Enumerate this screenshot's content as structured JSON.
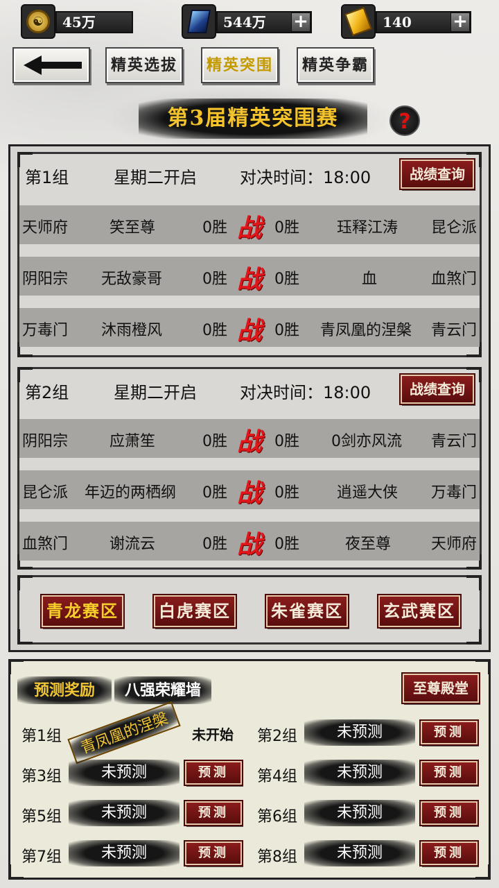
{
  "resources": [
    {
      "icon": "taiji-coin-icon",
      "value": "45万",
      "has_plus": false
    },
    {
      "icon": "blue-gem-icon",
      "value": "544万",
      "has_plus": true
    },
    {
      "icon": "gold-ingot-icon",
      "value": "140",
      "has_plus": true
    }
  ],
  "tabs": [
    {
      "label": "精英选拔",
      "active": false
    },
    {
      "label": "精英突围",
      "active": true
    },
    {
      "label": "精英争霸",
      "active": false
    }
  ],
  "title": "第3届精英突围赛",
  "help_symbol": "?",
  "groups": [
    {
      "name": "第1组",
      "open_day": "星期二开启",
      "duel_time": "对决时间：18:00",
      "record_button": "战绩查询",
      "matches": [
        {
          "left_sect": "天师府",
          "left_player": "笑至尊",
          "left_wins": "0胜",
          "vs": "战",
          "right_wins": "0胜",
          "right_player": "珏释江涛",
          "right_sect": "昆仑派"
        },
        {
          "left_sect": "阴阳宗",
          "left_player": "无敌豪哥",
          "left_wins": "0胜",
          "vs": "战",
          "right_wins": "0胜",
          "right_player": "血",
          "right_sect": "血煞门"
        },
        {
          "left_sect": "万毒门",
          "left_player": "沐雨橙风",
          "left_wins": "0胜",
          "vs": "战",
          "right_wins": "0胜",
          "right_player": "青凤凰的涅槃",
          "right_sect": "青云门"
        }
      ]
    },
    {
      "name": "第2组",
      "open_day": "星期二开启",
      "duel_time": "对决时间：18:00",
      "record_button": "战绩查询",
      "matches": [
        {
          "left_sect": "阴阳宗",
          "left_player": "应萧笙",
          "left_wins": "0胜",
          "vs": "战",
          "right_wins": "0胜",
          "right_player": "0剑亦风流",
          "right_sect": "青云门"
        },
        {
          "left_sect": "昆仑派",
          "left_player": "年迈的两栖纲",
          "left_wins": "0胜",
          "vs": "战",
          "right_wins": "0胜",
          "right_player": "逍遥大侠",
          "right_sect": "万毒门"
        },
        {
          "left_sect": "血煞门",
          "left_player": "谢流云",
          "left_wins": "0胜",
          "vs": "战",
          "right_wins": "0胜",
          "right_player": "夜至尊",
          "right_sect": "天师府"
        }
      ]
    }
  ],
  "zones": [
    {
      "label": "青龙赛区",
      "active": true
    },
    {
      "label": "白虎赛区",
      "active": false
    },
    {
      "label": "朱雀赛区",
      "active": false
    },
    {
      "label": "玄武赛区",
      "active": false
    }
  ],
  "prediction": {
    "tab_reward": "预测奖励",
    "tab_wall": "八强荣耀墙",
    "supreme_button": "至尊殿堂",
    "predict_button": "预测",
    "cells": [
      {
        "group": "第1组",
        "value": "青凤凰的涅槃",
        "status": "未开始",
        "highlight": true
      },
      {
        "group": "第2组",
        "value": "未预测",
        "status": "",
        "highlight": false
      },
      {
        "group": "第3组",
        "value": "未预测",
        "status": "",
        "highlight": false
      },
      {
        "group": "第4组",
        "value": "未预测",
        "status": "",
        "highlight": false
      },
      {
        "group": "第5组",
        "value": "未预测",
        "status": "",
        "highlight": false
      },
      {
        "group": "第6组",
        "value": "未预测",
        "status": "",
        "highlight": false
      },
      {
        "group": "第7组",
        "value": "未预测",
        "status": "",
        "highlight": false
      },
      {
        "group": "第8组",
        "value": "未预测",
        "status": "",
        "highlight": false
      }
    ]
  },
  "colors": {
    "accent_gold": "#f2c634",
    "vs_red": "#e2161a",
    "button_red": "#7a1717"
  }
}
